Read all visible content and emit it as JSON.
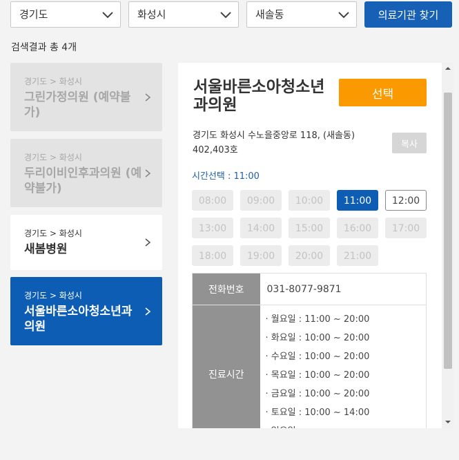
{
  "filters": {
    "province": "경기도",
    "city": "화성시",
    "district": "새솔동",
    "search_button": "의료기관 찾기"
  },
  "result_count": "검색결과 총 4개",
  "clinics": [
    {
      "region": "경기도 > 화성시",
      "name": "그린가정의원 (예약불가)",
      "state": "disabled"
    },
    {
      "region": "경기도 > 화성시",
      "name": "두리이비인후과의원 (예약불가)",
      "state": "disabled"
    },
    {
      "region": "경기도 > 화성시",
      "name": "새봄병원",
      "state": "normal"
    },
    {
      "region": "경기도 > 화성시",
      "name": "서울바른소아청소년과의원",
      "state": "selected"
    }
  ],
  "detail": {
    "name": "서울바른소아청소년과의원",
    "select_button": "선택",
    "address": "경기도 화성시 수노을중앙로 118, (새솔동) 402,403호",
    "copy_button": "복사",
    "time_selection": "시간선택 : 11:00",
    "slots": [
      "08:00",
      "09:00",
      "10:00",
      "11:00",
      "12:00",
      "13:00",
      "14:00",
      "15:00",
      "16:00",
      "17:00",
      "18:00",
      "19:00",
      "20:00",
      "21:00"
    ],
    "selected_slot": "11:00",
    "available_slots": [
      "12:00"
    ],
    "phone_label": "전화번호",
    "phone": "031-8077-9871",
    "hours_label": "진료시간",
    "hours": [
      "· 월요일 : 11:00 ~ 20:00",
      "· 화요일 : 10:00 ~ 20:00",
      "· 수요일 : 10:00 ~ 20:00",
      "· 목요일 : 10:00 ~ 20:00",
      "· 금요일 : 10:00 ~ 20:00",
      "· 토요일 : 10:00 ~ 14:00",
      "· 일요일"
    ]
  },
  "colors": {
    "primary": "#0e5db4",
    "accent": "#fa9a00",
    "disabled": "#e3e3e3"
  }
}
